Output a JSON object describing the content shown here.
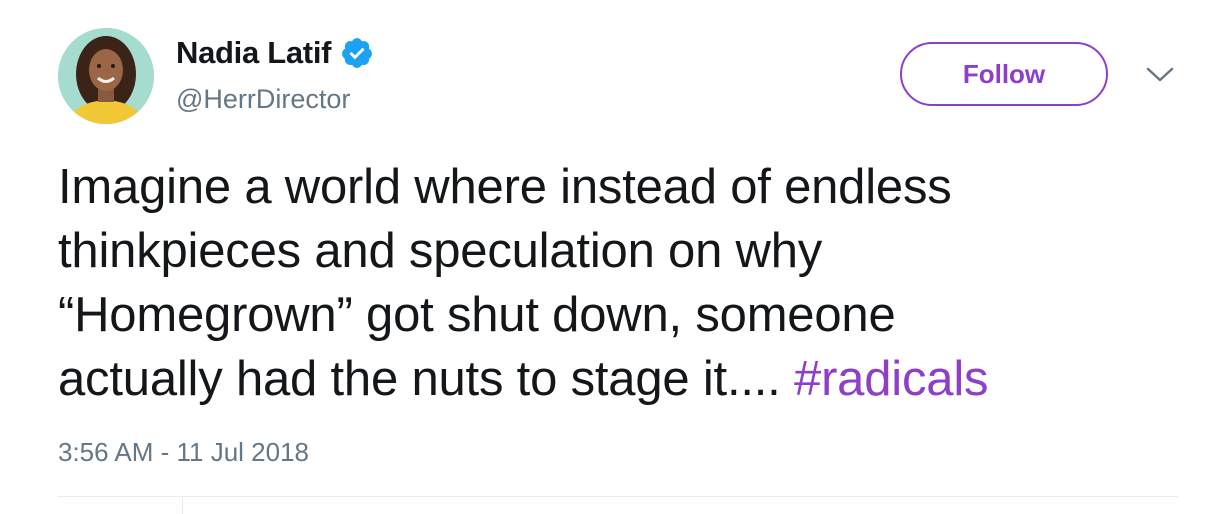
{
  "author": {
    "display_name": "Nadia Latif",
    "handle": "@HerrDirector",
    "verified": true
  },
  "follow_button": {
    "label": "Follow"
  },
  "tweet": {
    "text_lines": [
      "Imagine a world where instead of endless",
      "thinkpieces and speculation on why",
      "“Homegrown” got shut down, someone",
      "actually had the nuts to stage it.... "
    ],
    "hashtag": "#radicals",
    "timestamp": "3:56 AM - 11 Jul 2018"
  },
  "icons": {
    "verified": "verified-badge-icon",
    "more": "chevron-down-icon"
  },
  "colors": {
    "accent": "#8e3fc9",
    "verified_blue": "#1da1f2",
    "secondary_text": "#657786",
    "primary_text": "#14171a"
  }
}
